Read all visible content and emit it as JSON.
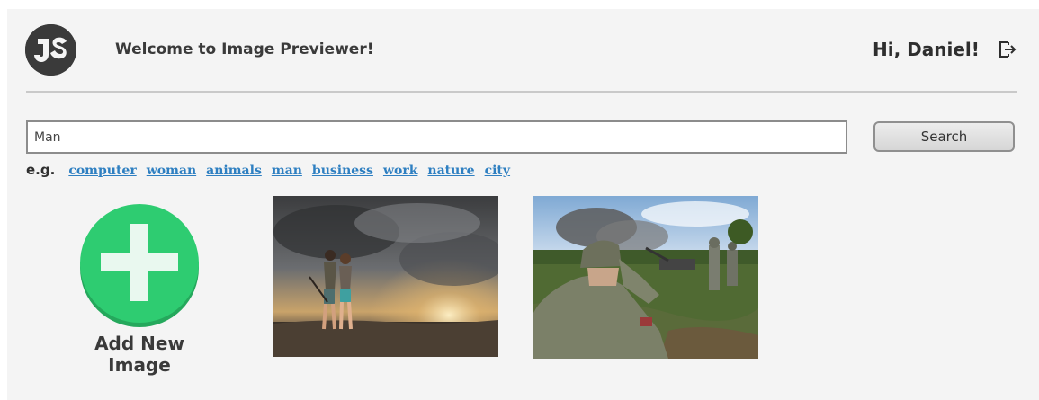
{
  "header": {
    "welcome_text": "Welcome to Image Previewer!",
    "greeting": "Hi, Daniel!",
    "logo_icon": "js-logo-icon",
    "logout_icon": "logout-icon"
  },
  "search": {
    "value": "Man",
    "button_label": "Search"
  },
  "suggestions": {
    "prefix": "e.g.",
    "links": [
      "computer",
      "woman",
      "animals",
      "man",
      "business",
      "work",
      "nature",
      "city"
    ]
  },
  "gallery": {
    "add_label": "Add New Image",
    "add_icon": "plus-icon",
    "accent_color": "#2ecc71",
    "link_color": "#2e7fc1"
  }
}
